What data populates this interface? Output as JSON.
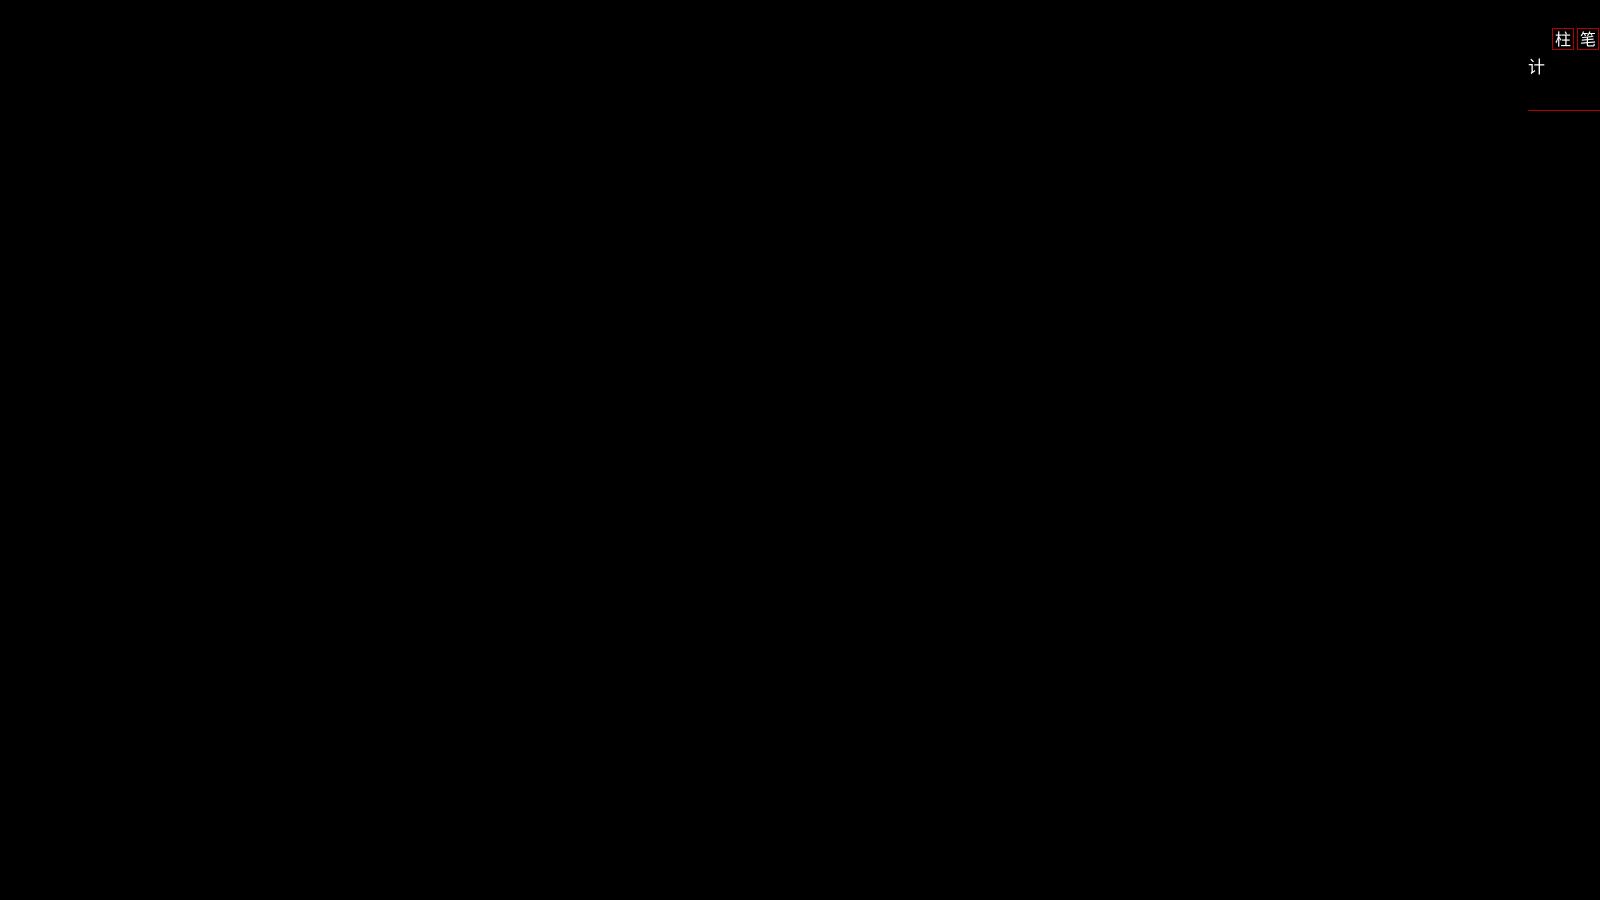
{
  "chart_data": {
    "type": "table",
    "buttons": [
      "柱",
      "笔"
    ],
    "label": "计"
  }
}
